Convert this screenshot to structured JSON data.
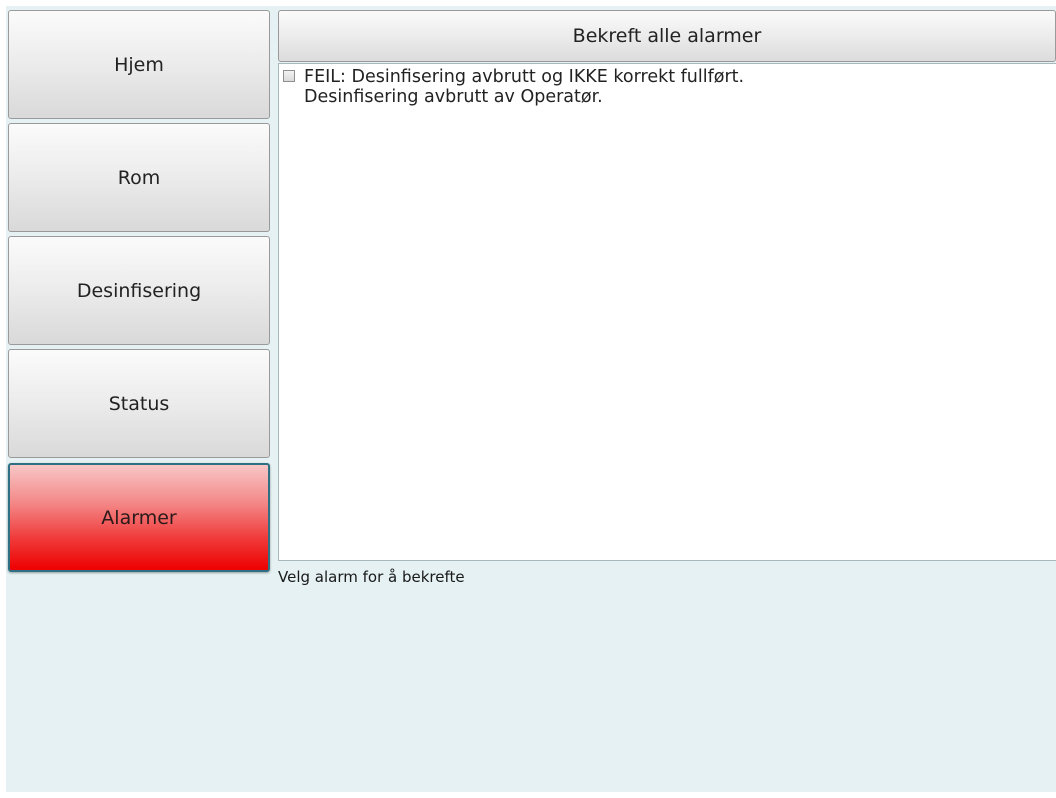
{
  "sidebar": {
    "items": [
      {
        "label": "Hjem"
      },
      {
        "label": "Rom"
      },
      {
        "label": "Desinfisering"
      },
      {
        "label": "Status"
      },
      {
        "label": "Alarmer",
        "active": true
      }
    ]
  },
  "alarms": {
    "confirm_all_label": "Bekreft alle alarmer",
    "items": [
      {
        "checked": false,
        "line1": "FEIL: Desinfisering avbrutt og IKKE korrekt fullført.",
        "line2": "Desinfisering avbrutt av Operatør."
      }
    ],
    "hint": "Velg alarm for å bekrefte"
  },
  "colors": {
    "background": "#e5f1f2",
    "active_alarm": "#ee0000",
    "active_border": "#2e6f83"
  }
}
